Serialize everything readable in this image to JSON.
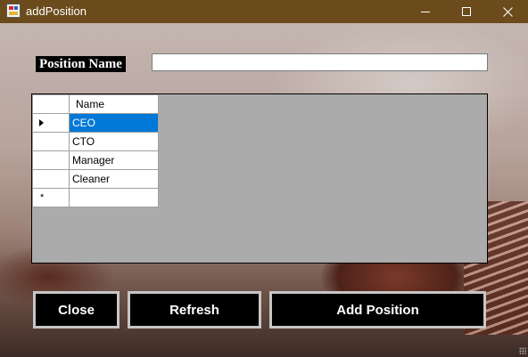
{
  "window": {
    "title": "addPosition",
    "controls": [
      "minimize-icon",
      "maximize-icon",
      "close-icon"
    ]
  },
  "form": {
    "label": "Position Name",
    "input_value": "",
    "input_placeholder": ""
  },
  "grid": {
    "columns": [
      "Name"
    ],
    "rows": [
      {
        "name": "CEO",
        "selected": true
      },
      {
        "name": "CTO",
        "selected": false
      },
      {
        "name": "Manager",
        "selected": false
      },
      {
        "name": "Cleaner",
        "selected": false
      }
    ],
    "current_row_glyph": "▶",
    "new_row_glyph": "*"
  },
  "buttons": {
    "close": "Close",
    "refresh": "Refresh",
    "add": "Add Position"
  },
  "colors": {
    "titlebar": "#6b4a1c",
    "selection": "#0078d7",
    "grid_background": "#ababab",
    "button_background": "#000000"
  }
}
